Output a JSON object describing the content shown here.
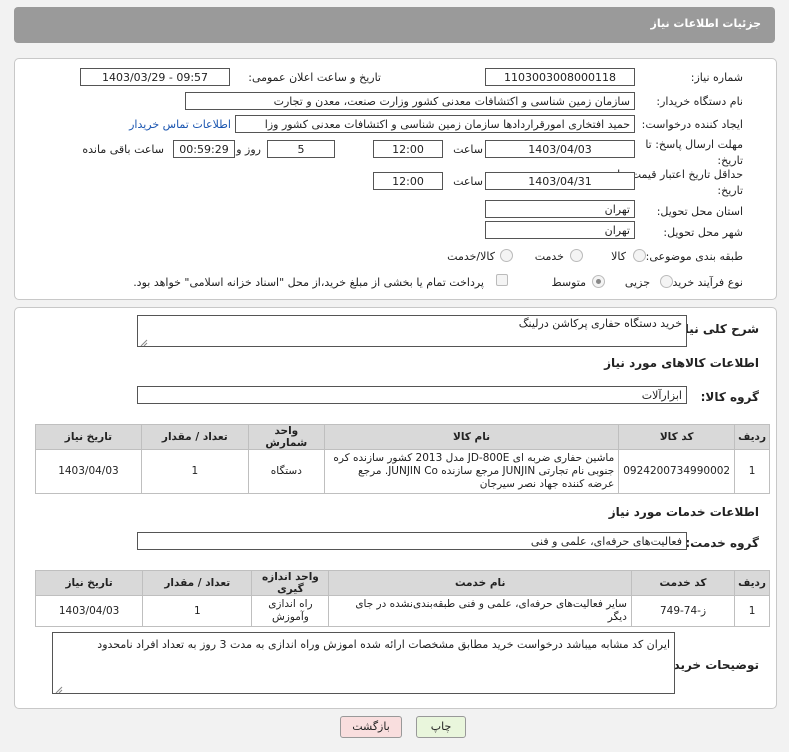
{
  "header": {
    "title": "جزئیات اطلاعات نیاز"
  },
  "form": {
    "need_number_label": "شماره نیاز:",
    "need_number": "1103003008000118",
    "announce_label": "تاریخ و ساعت اعلان عمومی:",
    "announce_value": "1403/03/29 - 09:57",
    "buyer_label": "نام دستگاه خریدار:",
    "buyer_value": "سازمان زمین شناسی و اکتشافات معدنی کشور وزارت صنعت، معدن و تجارت",
    "requester_label": "ایجاد کننده درخواست:",
    "requester_value": "حمید افتخاری امورقراردادها سازمان زمین شناسی و اکتشافات معدنی کشور وزا",
    "contact_link": "اطلاعات تماس خریدار",
    "deadline_label": "مهلت ارسال پاسخ: تا تاریخ:",
    "deadline_date": "1403/04/03",
    "time_label": "ساعت",
    "deadline_time": "12:00",
    "days_value": "5",
    "days_label": "روز و",
    "remaining_time": "00:59:29",
    "remaining_label": "ساعت باقی مانده",
    "validity_label": "حداقل تاریخ اعتبار قیمت: تا تاریخ:",
    "validity_date": "1403/04/31",
    "validity_time": "12:00",
    "province_label": "استان محل تحویل:",
    "province_value": "تهران",
    "city_label": "شهر محل تحویل:",
    "city_value": "تهران",
    "category_label": "طبقه بندی موضوعی:",
    "category_options": [
      "کالا",
      "خدمت",
      "کالا/خدمت"
    ],
    "process_label": "نوع فرآیند خرید :",
    "process_options": [
      "جزیی",
      "متوسط"
    ],
    "payment_note": "پرداخت تمام یا بخشی از مبلغ خرید،از محل \"اسناد خزانه اسلامی\" خواهد بود."
  },
  "summary": {
    "label": "شرح کلی نیاز:",
    "value": "خرید دستگاه حفاری پرکاشن درلینگ"
  },
  "goods": {
    "section_title": "اطلاعات کالاهای مورد نیاز",
    "group_label": "گروه کالا:",
    "group_value": "ابزارآلات",
    "columns": [
      "ردیف",
      "کد کالا",
      "نام کالا",
      "واحد شمارش",
      "تعداد / مقدار",
      "تاریخ نیاز"
    ],
    "rows": [
      {
        "row": "1",
        "code": "0924200734990002",
        "name": "ماشین حفاری ضربه ای JD-800E مدل 2013 کشور سازنده کره جنوبی نام تجارتی JUNJIN مرجع سازنده JUNJIN Co. مرجع عرضه کننده جهاد نصر سیرجان",
        "unit": "دستگاه",
        "qty": "1",
        "date": "1403/04/03"
      }
    ]
  },
  "services": {
    "section_title": "اطلاعات خدمات مورد نیاز",
    "group_label": "گروه خدمت:",
    "group_value": "فعالیت‌های حرفه‌ای، علمی و فنی",
    "columns": [
      "ردیف",
      "کد خدمت",
      "نام خدمت",
      "واحد اندازه گیری",
      "تعداد / مقدار",
      "تاریخ نیاز"
    ],
    "rows": [
      {
        "row": "1",
        "code": "ز-74-749",
        "name": "سایر فعالیت‌های حرفه‌ای، علمی و فنی طبقه‌بندی‌نشده در جای دیگر",
        "unit": "راه اندازی وآموزش",
        "qty": "1",
        "date": "1403/04/03"
      }
    ]
  },
  "notes": {
    "label": "توضیحات خریدار:",
    "value": "ایران کد مشابه میباشد درخواست خرید مطابق مشخصات ارائه شده  اموزش وراه اندازی به مدت 3 روز به تعداد افراد نامحدود"
  },
  "buttons": {
    "print": "چاپ",
    "back": "بازگشت"
  },
  "colors": {
    "header": "#9a9a9a",
    "print_button": "#e9f6dc",
    "back_button": "#f9dede"
  }
}
